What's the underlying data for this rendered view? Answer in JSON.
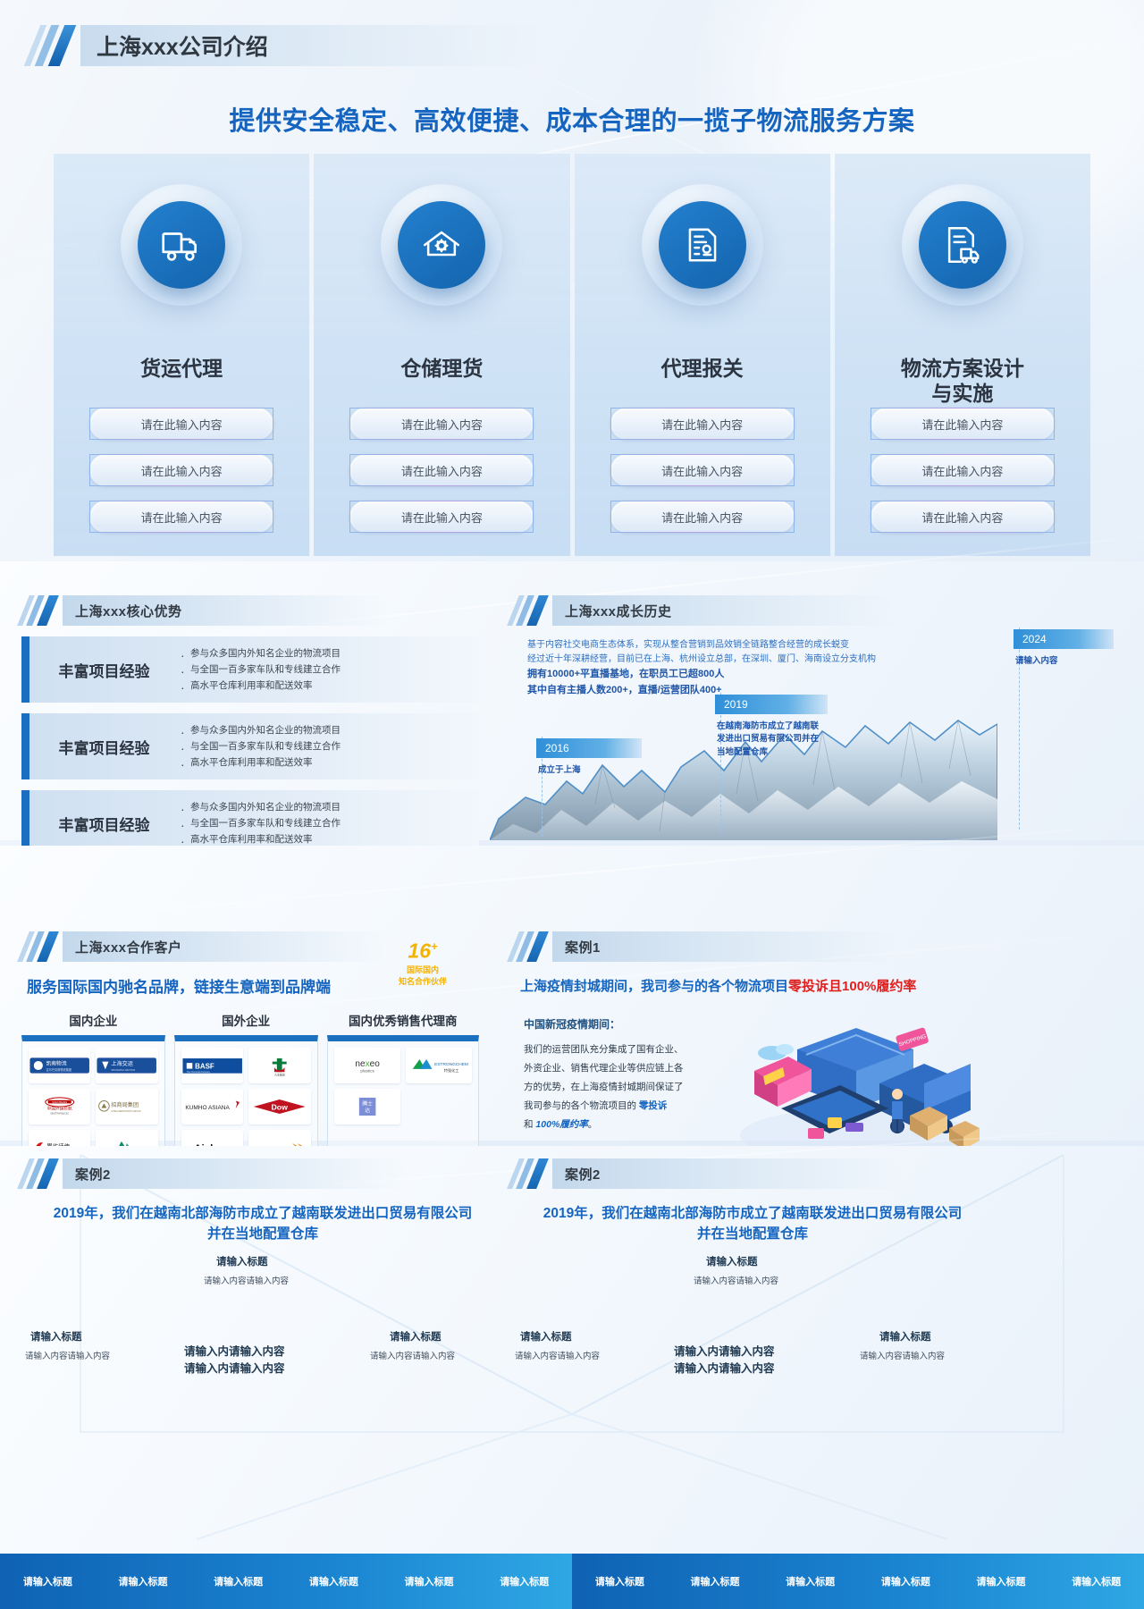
{
  "hero": {
    "title": "上海xxx公司介绍",
    "subtitle": "提供安全稳定、高效便捷、成本合理的一揽子物流服务方案"
  },
  "services": [
    {
      "icon": "truck-icon",
      "title": "货运代理",
      "pills": [
        "请在此输入内容",
        "请在此输入内容",
        "请在此输入内容"
      ]
    },
    {
      "icon": "warehouse-gear-icon",
      "title": "仓储理货",
      "pills": [
        "请在此输入内容",
        "请在此输入内容",
        "请在此输入内容"
      ]
    },
    {
      "icon": "customs-document-icon",
      "title": "代理报关",
      "pills": [
        "请在此输入内容",
        "请在此输入内容",
        "请在此输入内容"
      ]
    },
    {
      "icon": "logistics-plan-icon",
      "title": "物流方案设计\n与实施",
      "pills": [
        "请在此输入内容",
        "请在此输入内容",
        "请在此输入内容"
      ]
    }
  ],
  "advantages": {
    "section_title": "上海xxx核心优势",
    "items": [
      {
        "label": "丰富项目经验",
        "bullets": [
          "参与众多国内外知名企业的物流项目",
          "与全国一百多家车队和专线建立合作",
          "高水平仓库利用率和配送效率"
        ]
      },
      {
        "label": "丰富项目经验",
        "bullets": [
          "参与众多国内外知名企业的物流项目",
          "与全国一百多家车队和专线建立合作",
          "高水平仓库利用率和配送效率"
        ]
      },
      {
        "label": "丰富项目经验",
        "bullets": [
          "参与众多国内外知名企业的物流项目",
          "与全国一百多家车队和专线建立合作",
          "高水平仓库利用率和配送效率"
        ]
      }
    ]
  },
  "history": {
    "section_title": "上海xxx成长历史",
    "paragraph_line1": "基于内容社交电商生态体系，实现从整合营销到品效销全链路整合经营的成长蜕变",
    "paragraph_line2": "经过近十年深耕经营，目前已在上海、杭州设立总部，在深圳、厦门、海南设立分支机构",
    "paragraph_line3": "拥有10000+平直播基地，在职员工已超800人",
    "paragraph_line4": "其中自有主播人数200+，直播/运营团队400+",
    "milestones": [
      {
        "year": "2016",
        "text": "成立于上海"
      },
      {
        "year": "2019",
        "text": "在越南海防市成立了越南联发进出口贸易有限公司并在当地配置仓库"
      },
      {
        "year": "2024",
        "text": "请输入内容"
      }
    ]
  },
  "partners": {
    "section_title": "上海xxx合作客户",
    "lead": "服务国际国内驰名品牌，链接生意端到品牌端",
    "badge": {
      "number": "16",
      "plus": "+",
      "line1": "国际国内",
      "line2": "知名合作伙伴"
    },
    "columns": [
      {
        "header": "国内企业",
        "logos": [
          "湘南物流 吉尔巴克斯物流",
          "上海交运 SHANGHAI JIAOYUN",
          "中国外运长航 SINOTRANS&CSC",
          "招商局集团 CHINA MERCHANTS GROUP",
          "累屿速传 XHXYG SUPERCHAIN",
          "绿色塔形标志",
          "红色飞鸟标志"
        ]
      },
      {
        "header": "国外企业",
        "logos": [
          "BASF The Chemical Company",
          "九丰集团",
          "KUMHO ASIANA",
          "Dow",
          "Aicksn.",
          "CABOT"
        ]
      },
      {
        "header": "国内优秀销售代理商",
        "logos": [
          "nexeo plastics",
          "ESTRONGCHEM 特强化工",
          "腾士达"
        ]
      }
    ]
  },
  "case1": {
    "section_title": "案例1",
    "lead_prefix": "上海疫情封城期间，我司参与的各个物流项目",
    "lead_highlight": "零投诉且100%履约率",
    "sub": "中国新冠疫情期间：",
    "body_line1": "我们的运营团队充分集成了国有企业、",
    "body_line2": "外资企业、销售代理企业等供应链上各",
    "body_line3": "方的优势，在上海疫情封城期间保证了",
    "body_line4_a": "我司参与的各个物流项目的 ",
    "body_line4_b": "零投诉",
    "body_line5_a": "和 ",
    "body_line5_b": "100%履约率",
    "body_line5_c": "。"
  },
  "case2_left": {
    "section_title": "案例2",
    "lead_line1": "2019年，我们在越南北部海防市成立了越南联发进出口贸易有限公司",
    "lead_line2": "并在当地配置仓库",
    "blocks": [
      {
        "title": "请输入标题",
        "desc": "请输入内容请输入内容"
      },
      {
        "title": "请输入标题",
        "desc": "请输入内容请输入内容"
      },
      {
        "title": "请输入标题",
        "desc": "请输入内容请输入内容"
      }
    ],
    "center_text_line1": "请输入内请输入内容",
    "center_text_line2": "请输入内请输入内容"
  },
  "case2_right": {
    "section_title": "案例2",
    "lead_line1": "2019年，我们在越南北部海防市成立了越南联发进出口贸易有限公司",
    "lead_line2": "并在当地配置仓库",
    "blocks": [
      {
        "title": "请输入标题",
        "desc": "请输入内容请输入内容"
      },
      {
        "title": "请输入标题",
        "desc": "请输入内容请输入内容"
      },
      {
        "title": "请输入标题",
        "desc": "请输入内容请输入内容"
      }
    ],
    "center_text_line1": "请输入内请输入内容",
    "center_text_line2": "请输入内请输入内容"
  },
  "footer": {
    "left_items": [
      "请输入标题",
      "请输入标题",
      "请输入标题",
      "请输入标题",
      "请输入标题",
      "请输入标题"
    ],
    "right_items": [
      "请输入标题",
      "请输入标题",
      "请输入标题",
      "请输入标题",
      "请输入标题",
      "请输入标题"
    ]
  },
  "colors": {
    "brand_blue": "#1565c0",
    "deep_blue": "#1464ad",
    "accent_red": "#e01f1f",
    "badge_yellow": "#f5b301",
    "footer_gradient_start": "#0f62b4",
    "footer_gradient_end": "#2fa7e4"
  }
}
